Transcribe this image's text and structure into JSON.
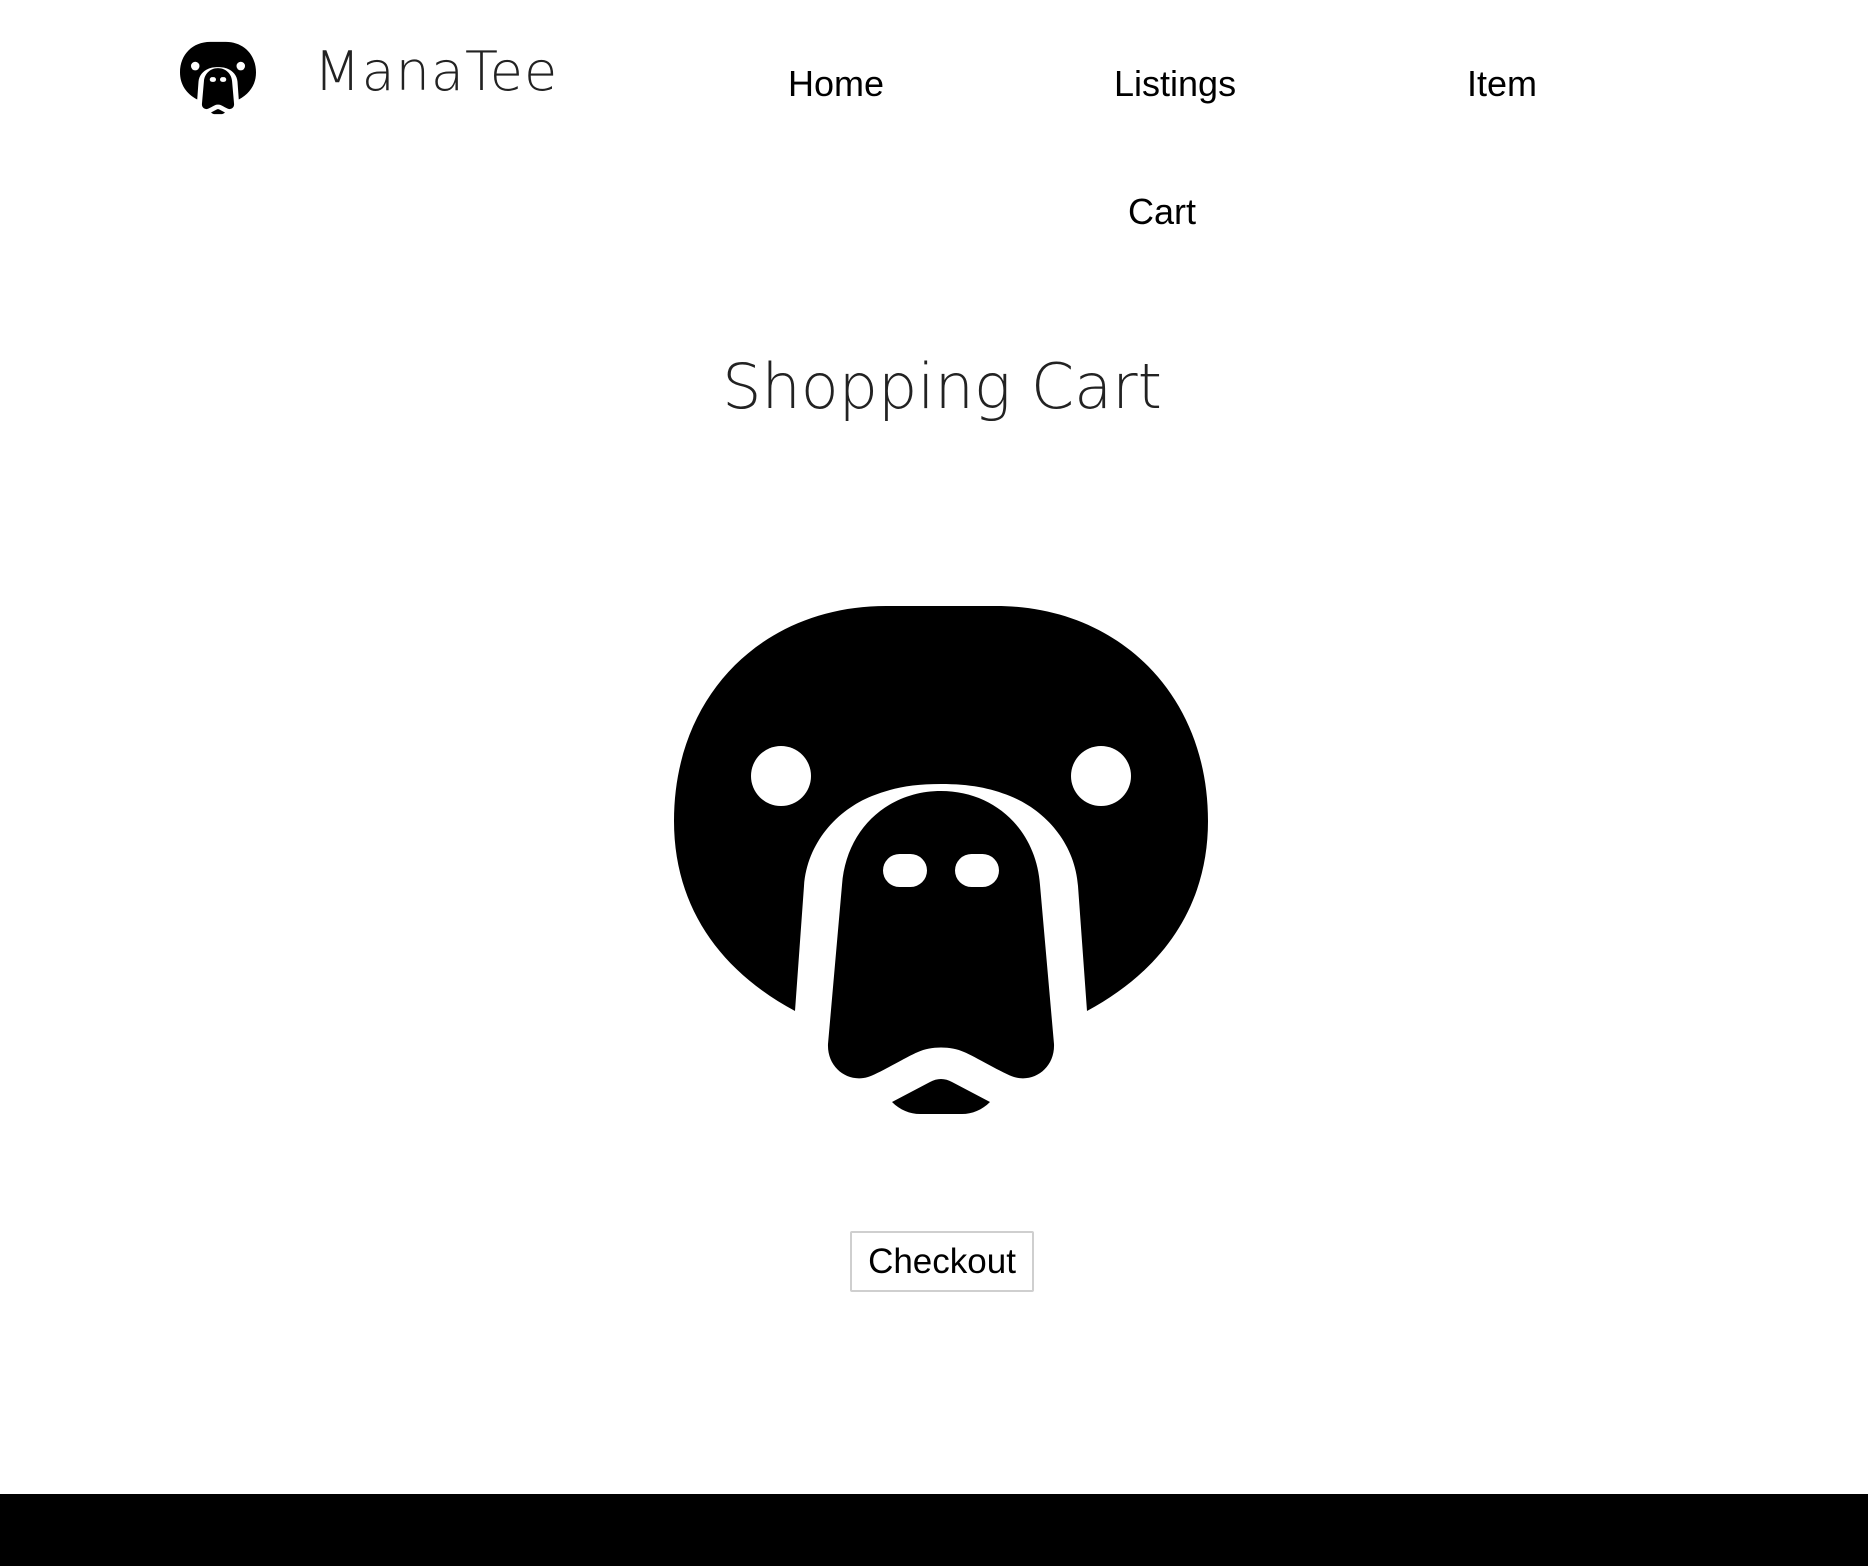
{
  "header": {
    "logo_icon": "manatee-logo-icon",
    "brand": "ManaTee"
  },
  "nav": {
    "home": "Home",
    "listings": "Listings",
    "item": "Item",
    "cart": "Cart"
  },
  "main": {
    "title": "Shopping Cart",
    "hero_icon": "manatee-face-icon",
    "checkout_label": "Checkout"
  },
  "colors": {
    "background": "#ffffff",
    "text": "#000000",
    "title_text": "#222222",
    "footer": "#000000",
    "button_border": "#cfcfcf"
  }
}
